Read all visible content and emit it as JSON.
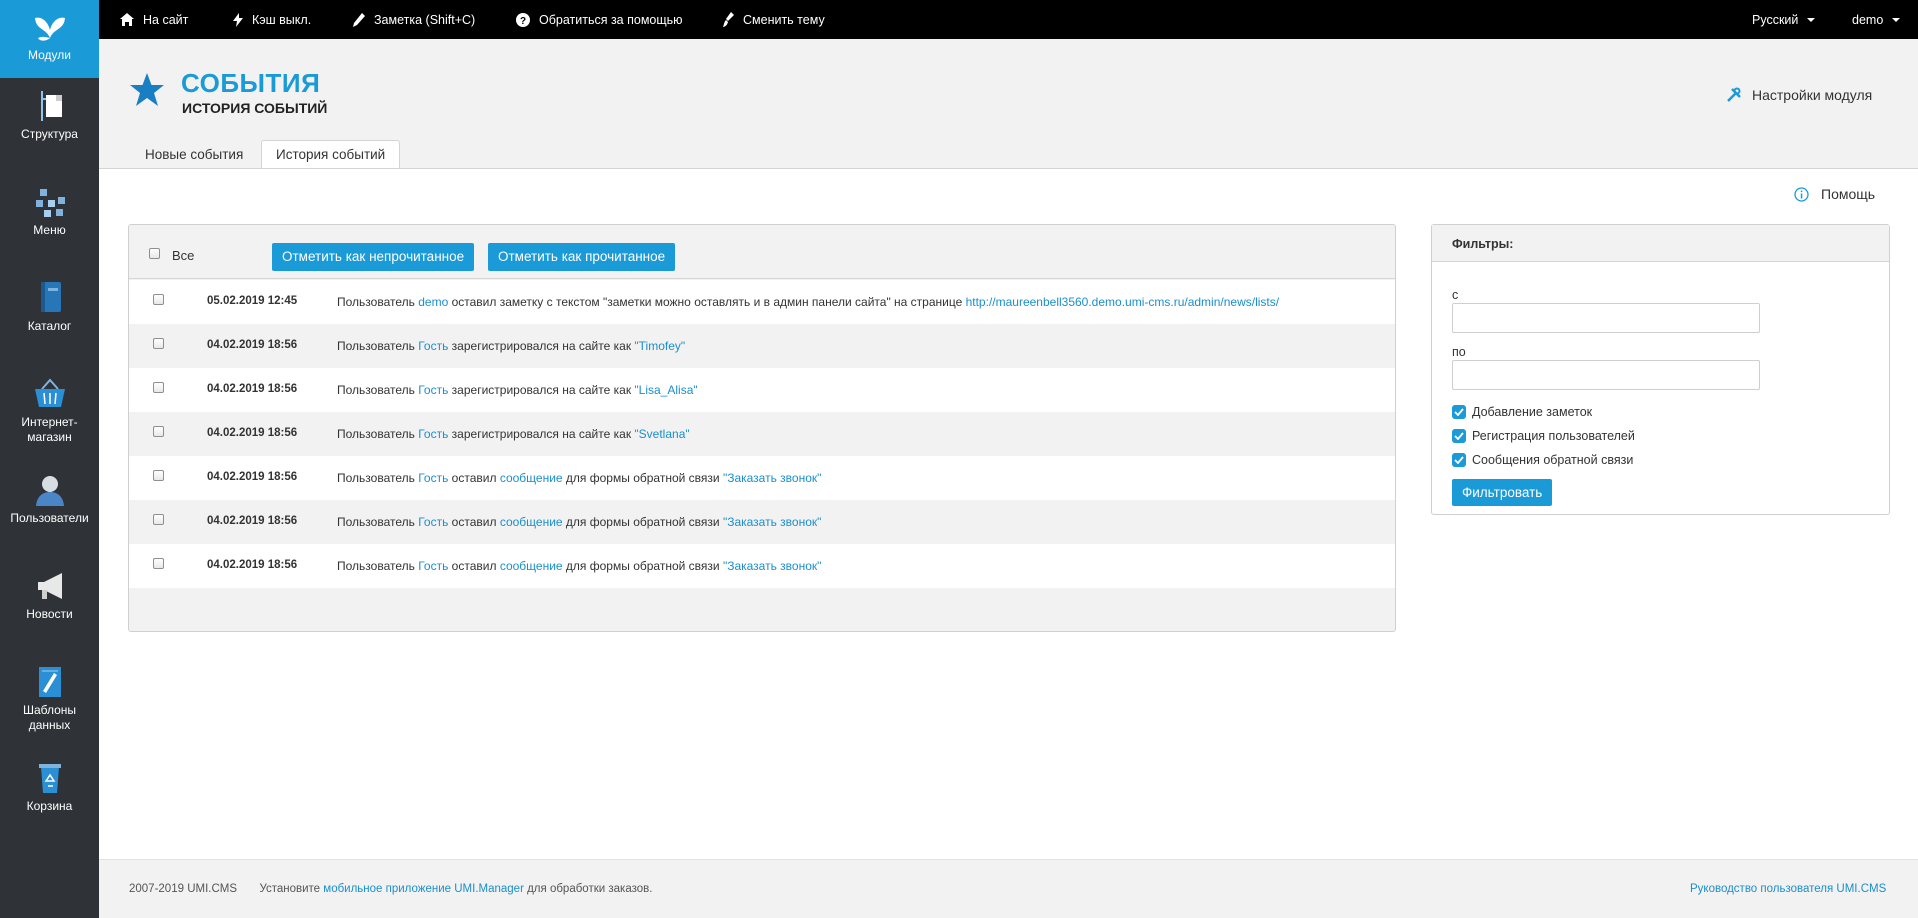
{
  "sidebar": {
    "items": [
      {
        "label": "Модули",
        "icon": "butterfly-icon",
        "active": true
      },
      {
        "label": "Структура",
        "icon": "document-tree-icon"
      },
      {
        "label": "Меню",
        "icon": "menu-tree-icon"
      },
      {
        "label": "Каталог",
        "icon": "book-icon"
      },
      {
        "label": "Интернет-магазин",
        "icon": "basket-icon"
      },
      {
        "label": "Пользователи",
        "icon": "user-icon"
      },
      {
        "label": "Новости",
        "icon": "megaphone-icon"
      },
      {
        "label": "Шаблоны данных",
        "icon": "blueprint-icon"
      },
      {
        "label": "Корзина",
        "icon": "recycle-bin-icon"
      }
    ]
  },
  "topbar": {
    "site": "На сайт",
    "cache": "Кэш выкл.",
    "note": "Заметка (Shift+C)",
    "support": "Обратиться за помощью",
    "theme": "Сменить тему",
    "language": "Русский",
    "user": "demo"
  },
  "header": {
    "title": "СОБЫТИЯ",
    "subtitle": "ИСТОРИЯ СОБЫТИЙ",
    "module_settings": "Настройки модуля",
    "accent": "#1a9ad6"
  },
  "tabs": [
    {
      "label": "Новые события"
    },
    {
      "label": "История событий",
      "active": true
    }
  ],
  "help": "Помощь",
  "events": {
    "all_label": "Все",
    "mark_unread": "Отметить как непрочитанное",
    "mark_read": "Отметить как прочитанное",
    "rows": [
      {
        "date": "05.02.2019 12:45",
        "p1": "Пользователь ",
        "user": "demo",
        "p2": " оставил заметку с текстом \"заметки можно оставлять и в админ панели сайта\" на странице ",
        "link": "http://maureenbell3560.demo.umi-cms.ru/admin/news/lists/"
      },
      {
        "date": "04.02.2019 18:56",
        "p1": "Пользователь ",
        "user": "Гость",
        "p2": " зарегистрировался на сайте как ",
        "link": "\"Timofey\""
      },
      {
        "date": "04.02.2019 18:56",
        "p1": "Пользователь ",
        "user": "Гость",
        "p2": " зарегистрировался на сайте как ",
        "link": "\"Lisa_Alisa\""
      },
      {
        "date": "04.02.2019 18:56",
        "p1": "Пользователь ",
        "user": "Гость",
        "p2": " зарегистрировался на сайте как ",
        "link": "\"Svetlana\""
      },
      {
        "date": "04.02.2019 18:56",
        "p1": "Пользователь ",
        "user": "Гость",
        "p2": " оставил ",
        "msg": "сообщение",
        "p3": " для формы обратной связи ",
        "link": "\"Заказать звонок\""
      },
      {
        "date": "04.02.2019 18:56",
        "p1": "Пользователь ",
        "user": "Гость",
        "p2": " оставил ",
        "msg": "сообщение",
        "p3": " для формы обратной связи ",
        "link": "\"Заказать звонок\""
      },
      {
        "date": "04.02.2019 18:56",
        "p1": "Пользователь ",
        "user": "Гость",
        "p2": " оставил ",
        "msg": "сообщение",
        "p3": " для формы обратной связи ",
        "link": "\"Заказать звонок\""
      }
    ]
  },
  "filters": {
    "title": "Фильтры:",
    "from_label": "с",
    "to_label": "по",
    "from_value": "",
    "to_value": "",
    "checks": [
      {
        "label": "Добавление заметок",
        "checked": true
      },
      {
        "label": "Регистрация пользователей",
        "checked": true
      },
      {
        "label": "Сообщения обратной связи",
        "checked": true
      }
    ],
    "apply": "Фильтровать"
  },
  "footer": {
    "copyright": "2007-2019 UMI.CMS",
    "install_text": "Установите ",
    "app_link": "мобильное приложение UMI.Manager",
    "install_suffix": " для обработки заказов.",
    "guide_link": "Руководство пользователя UMI.CMS"
  }
}
